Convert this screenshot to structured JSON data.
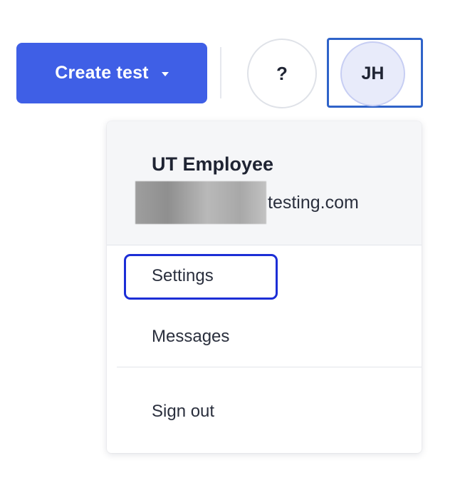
{
  "header": {
    "create_button_label": "Create test",
    "create_button_caret_icon": "caret-down-icon",
    "help_button_label": "?",
    "avatar_initials": "JH"
  },
  "account_menu": {
    "user_name": "UT Employee",
    "email_visible_part": "testing.com",
    "email_redacted": true,
    "items": [
      {
        "label": "Settings",
        "focused": true
      },
      {
        "label": "Messages",
        "focused": false
      },
      {
        "label": "Sign out",
        "focused": false
      }
    ]
  },
  "colors": {
    "primary_button": "#3f5fe6",
    "focus_ring": "#1c2ed6",
    "avatar_focus_ring": "#2f63c9",
    "avatar_bg": "#e8ebfa",
    "menu_header_bg": "#f5f6f8",
    "text_dark": "#1f2433"
  }
}
